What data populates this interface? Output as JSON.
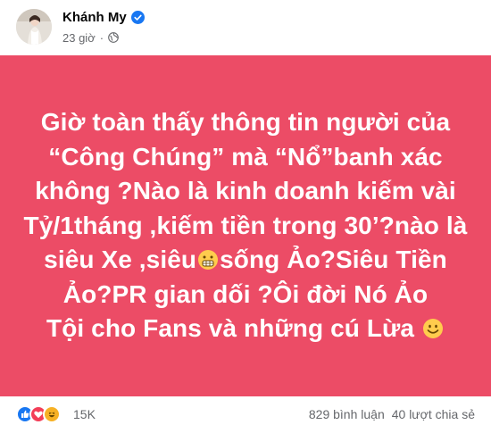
{
  "header": {
    "author": "Khánh My",
    "time": "23 giờ",
    "separator": "·",
    "verified_icon": "verified-badge-icon",
    "privacy_icon": "globe-icon"
  },
  "post": {
    "background_color": "#ec4c66",
    "text_color": "#ffffff",
    "lines": [
      "Giờ toàn thấy thông tin người của",
      "“Công Chúng” mà “Nổ”banh xác",
      "không ?Nào là kinh doanh kiếm vài",
      "Tỷ/1tháng ,kiếm tiền trong 30’?nào là",
      "siêu Xe ,siêu",
      "sống Ảo?Siêu Tiền",
      "Ảo?PR gian dối ?Ôi đời Nó Ảo",
      "Tội cho Fans và những cú Lừa",
      " "
    ],
    "emojis": [
      "grimacing-face-icon",
      "smiling-face-icon"
    ]
  },
  "footer": {
    "reaction_icons": [
      "like-icon",
      "love-icon",
      "haha-icon"
    ],
    "reaction_count": "15K",
    "comments": "829 bình luận",
    "shares": "40 lượt chia sẻ"
  }
}
